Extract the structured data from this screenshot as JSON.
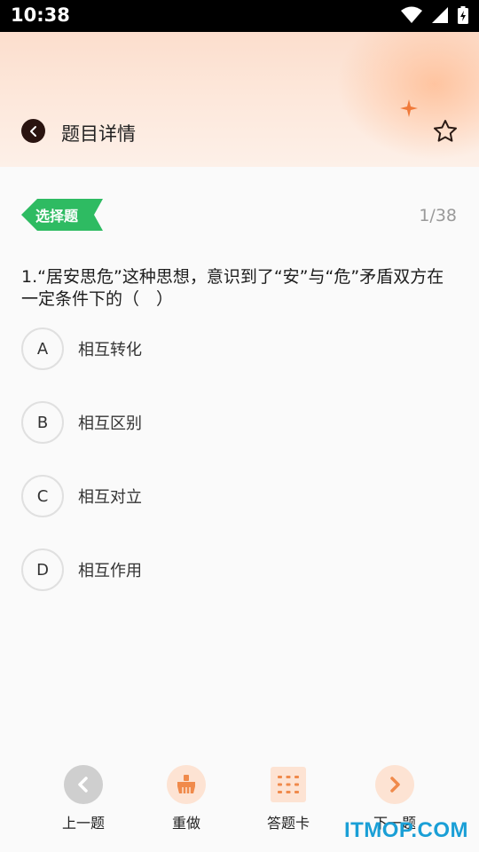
{
  "status_bar": {
    "time": "10:38"
  },
  "header": {
    "title": "题目详情",
    "back_icon": "chevron-left-icon",
    "favorite_icon": "star-outline-icon"
  },
  "question": {
    "type_tag": "选择题",
    "progress": "1/38",
    "text": "1.“居安思危”这种思想，意识到了“安”与“危”矛盾双方在一定条件下的（　）",
    "options": [
      {
        "letter": "A",
        "text": "相互转化"
      },
      {
        "letter": "B",
        "text": "相互区别"
      },
      {
        "letter": "C",
        "text": "相互对立"
      },
      {
        "letter": "D",
        "text": "相互作用"
      }
    ]
  },
  "bottom_nav": {
    "prev": "上一题",
    "redo": "重做",
    "answer_card": "答题卡",
    "next": "下一题"
  },
  "colors": {
    "tag_green": "#2ebb62",
    "accent_orange": "#f08a4b",
    "header_peach": "#fbd9c6"
  },
  "watermark": "ITMOP.COM"
}
